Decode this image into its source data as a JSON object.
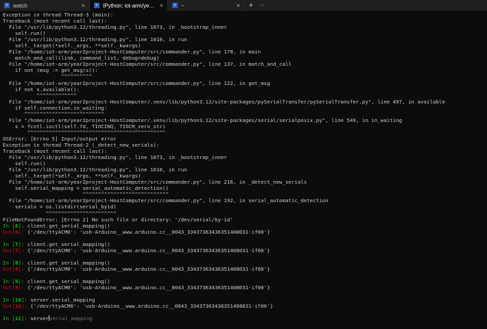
{
  "tabs": [
    {
      "label": "watch",
      "close": "×"
    },
    {
      "label": "IPython: iot-arm/year2project-",
      "close": "×"
    },
    {
      "label": "~",
      "close": "×"
    }
  ],
  "controls": {
    "new_tab": "+",
    "dropdown": "⌵"
  },
  "colors": {
    "background": "#0c0c0c",
    "text": "#cccccc",
    "in_prompt": "#16c60c",
    "out_prompt": "#c50f1f",
    "tab_icon": "#2b5fc1"
  },
  "terminal": {
    "lines": [
      {
        "text": "Exception in thread Thread-3 (main):"
      },
      {
        "text": "Traceback (most recent call last):"
      },
      {
        "text": "  File \"/usr/lib/python3.12/threading.py\", line 1073, in _bootstrap_inner"
      },
      {
        "text": "    self.run()"
      },
      {
        "text": "  File \"/usr/lib/python3.12/threading.py\", line 1010, in run"
      },
      {
        "text": "    self._target(*self._args, **self._kwargs)"
      },
      {
        "text": "  File \"/home/iot-arm/year2project-HostComputer/src/commander.py\", line 178, in main"
      },
      {
        "text": "    match_and_call(link, command_list, debug=debug)"
      },
      {
        "text": "  File \"/home/iot-arm/year2project-HostComputer/src/commander.py\", line 137, in match_and_call"
      },
      {
        "text": "    if not (msg := get_msg(s)):"
      },
      {
        "text": "                   ^^^^^^^^^^"
      },
      {
        "text": "  File \"/home/iot-arm/year2project-HostComputer/src/commander.py\", line 122, in get_msg"
      },
      {
        "text": "    if not s.available():"
      },
      {
        "text": "           ^^^^^^^^^^^^^"
      },
      {
        "text": "  File \"/home/iot-arm/year2project-HostComputer/.venv/lib/python3.12/site-packages/pySerialTransfer/pySerialTransfer.py\", line 497, in available"
      },
      {
        "text": "    if self.connection.in_waiting:"
      },
      {
        "text": "       ^^^^^^^^^^^^^^^^^^^^^^^^^^"
      },
      {
        "text": "  File \"/home/iot-arm/year2project-HostComputer/.venv/lib/python3.12/site-packages/serial/serialposix.py\", line 549, in in_waiting"
      },
      {
        "text": "    s = fcntl.ioctl(self.fd, TIOCINQ, TIOCM_zero_str)"
      },
      {
        "text": "        ^^^^^^^^^^^^^^^^^^^^^^^^^^^^^^^^^^^^^^^^^^^^^"
      },
      {
        "text": "OSError: [Errno 5] Input/output error"
      },
      {
        "text": "Exception in thread Thread-2 (_detect_new_serials):"
      },
      {
        "text": "Traceback (most recent call last):"
      },
      {
        "text": "  File \"/usr/lib/python3.12/threading.py\", line 1073, in _bootstrap_inner"
      },
      {
        "text": "    self.run()"
      },
      {
        "text": "  File \"/usr/lib/python3.12/threading.py\", line 1010, in run"
      },
      {
        "text": "    self._target(*self._args, **self._kwargs)"
      },
      {
        "text": "  File \"/home/iot-arm/year2project-HostComputer/src/commander.py\", line 216, in _detect_new_serials"
      },
      {
        "text": "    self.serial_mapping = serial_automatic_detection()"
      },
      {
        "text": "                          ^^^^^^^^^^^^^^^^^^^^^^^^^^^^"
      },
      {
        "text": "  File \"/home/iot-arm/year2project-HostComputer/src/commander.py\", line 192, in serial_automatic_detection"
      },
      {
        "text": "    serials = os.listdir(serial_byid)"
      },
      {
        "text": "              ^^^^^^^^^^^^^^^^^^^^^^^"
      },
      {
        "text": "FileNotFoundError: [Errno 2] No such file or directory: '/dev/serial/by-id'"
      },
      {
        "kind": "in",
        "prompt": "In [",
        "num": "6",
        "close": "]: ",
        "text": "client.get_serial_mapping()"
      },
      {
        "kind": "out",
        "prompt": "Out[",
        "num": "6",
        "close": "]: ",
        "text": "{'/dev/ttyACM0': 'usb-Arduino__www.arduino.cc__0043_33437363436351408031-if00'}"
      },
      {
        "text": ""
      },
      {
        "kind": "in",
        "prompt": "In [",
        "num": "7",
        "close": "]: ",
        "text": "client.get_serial_mapping()"
      },
      {
        "kind": "out",
        "prompt": "Out[",
        "num": "7",
        "close": "]: ",
        "text": "{'/dev/ttyACM0': 'usb-Arduino__www.arduino.cc__0043_33437363436351408031-if00'}"
      },
      {
        "text": ""
      },
      {
        "kind": "in",
        "prompt": "In [",
        "num": "8",
        "close": "]: ",
        "text": "client.get_serial_mapping()"
      },
      {
        "kind": "out",
        "prompt": "Out[",
        "num": "8",
        "close": "]: ",
        "text": "{'/dev/ttyACM0': 'usb-Arduino__www.arduino.cc__0043_33437363436351408031-if00'}"
      },
      {
        "text": ""
      },
      {
        "kind": "in",
        "prompt": "In [",
        "num": "9",
        "close": "]: ",
        "text": "client.get_serial_mapping()"
      },
      {
        "kind": "out",
        "prompt": "Out[",
        "num": "9",
        "close": "]: ",
        "text": "{'/dev/ttyACM0': 'usb-Arduino__www.arduino.cc__0043_33437363436351408031-if00'}"
      },
      {
        "text": ""
      },
      {
        "kind": "in",
        "prompt": "In [",
        "num": "10",
        "close": "]: ",
        "text": "server.serial_mapping"
      },
      {
        "kind": "out",
        "prompt": "Out[",
        "num": "10",
        "close": "]: ",
        "text": "{'/dev/ttyACM0': 'usb-Arduino__www.arduino.cc__0043_33437363436351408031-if00'}"
      },
      {
        "text": ""
      }
    ],
    "current_input": {
      "prompt": "In [",
      "num": "11",
      "close": "]: ",
      "typed": "server",
      "suggestion": "serial_mapping"
    }
  }
}
